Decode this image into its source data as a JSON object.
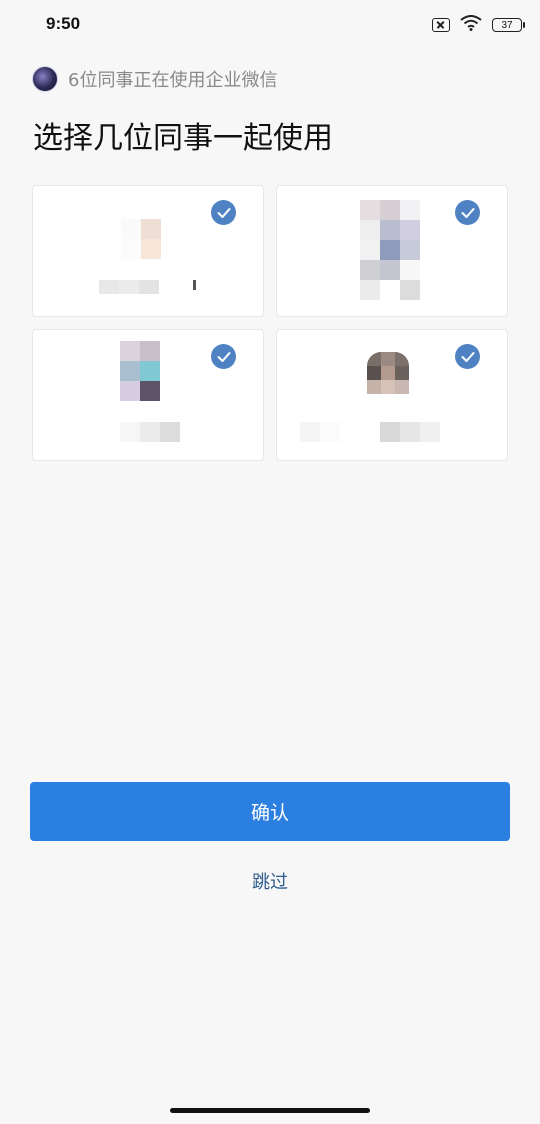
{
  "status_bar": {
    "time": "9:50",
    "battery": "37"
  },
  "header": {
    "company_text": "6位同事正在使用企业微信",
    "title": "选择几位同事一起使用"
  },
  "colleagues": [
    {
      "selected": true
    },
    {
      "selected": true
    },
    {
      "selected": true
    },
    {
      "selected": true
    }
  ],
  "actions": {
    "confirm_label": "确认",
    "skip_label": "跳过"
  },
  "colors": {
    "accent": "#2b7fe0",
    "check": "#4f82c3",
    "link": "#2f5d8e"
  }
}
